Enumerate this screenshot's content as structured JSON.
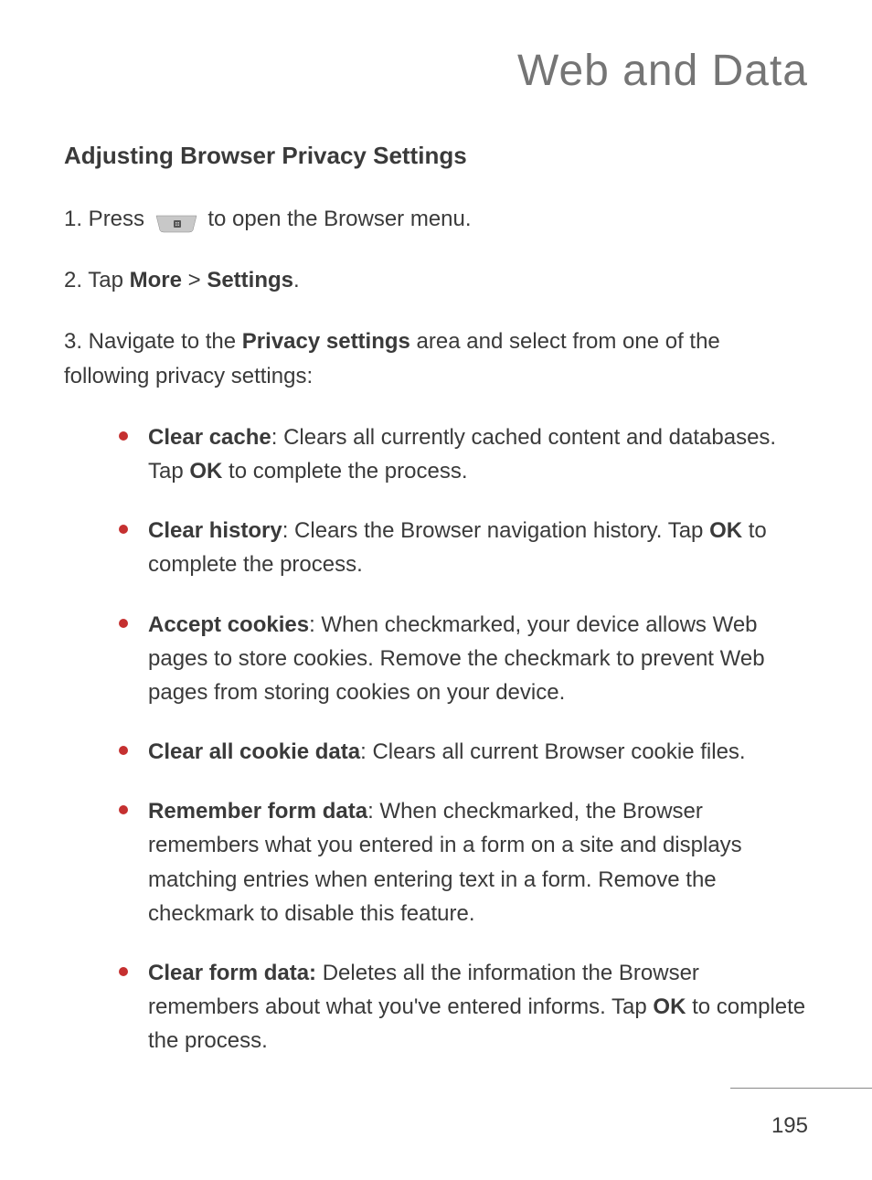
{
  "page_title": "Web and Data",
  "section_heading": "Adjusting Browser Privacy Settings",
  "step1_prefix": "1. Press ",
  "step1_suffix": " to open the Browser menu.",
  "step2_prefix": "2. Tap ",
  "step2_bold1": "More",
  "step2_mid": " > ",
  "step2_bold2": "Settings",
  "step2_suffix": ".",
  "step3_prefix": "3. Navigate to the ",
  "step3_bold": "Privacy settings",
  "step3_suffix": " area and select from one of the following privacy settings:",
  "bullets": {
    "b1_bold": "Clear cache",
    "b1_text1": ": Clears all currently cached content and databases. Tap ",
    "b1_bold2": "OK",
    "b1_text2": " to complete the process.",
    "b2_bold": "Clear history",
    "b2_text1": ": Clears the Browser navigation history. Tap ",
    "b2_bold2": "OK",
    "b2_text2": " to complete the process.",
    "b3_bold": "Accept cookies",
    "b3_text": ": When checkmarked, your device allows Web pages to store cookies. Remove the checkmark to prevent Web pages from storing cookies on your device.",
    "b4_bold": "Clear all cookie data",
    "b4_text": ": Clears all current Browser cookie files.",
    "b5_bold": "Remember form data",
    "b5_text": ": When checkmarked, the Browser remembers what you entered in a form on a site and displays matching entries when entering text in a form. Remove the checkmark to disable this feature.",
    "b6_bold": "Clear form data:",
    "b6_text1": " Deletes all the information the Browser remembers about what you've entered informs. Tap ",
    "b6_bold2": "OK",
    "b6_text2": " to complete the process."
  },
  "page_number": "195"
}
